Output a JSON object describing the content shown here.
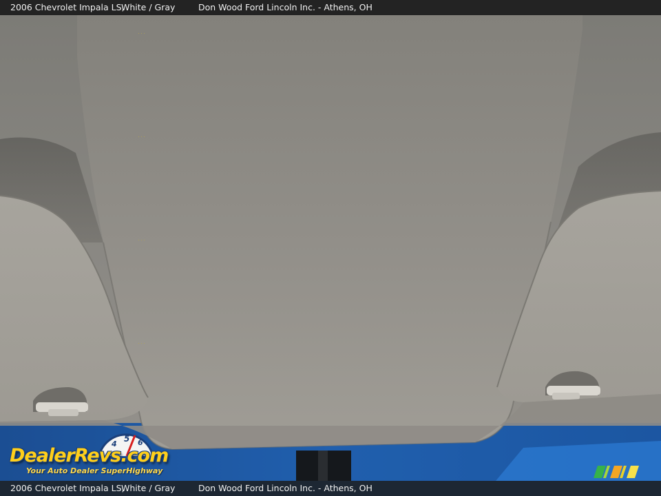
{
  "caption": {
    "vehicle": "2006 Chevrolet Impala LS,",
    "colors": "White / Gray",
    "dealer": "Don Wood Ford Lincoln Inc. - Athens, OH"
  },
  "watermark": {
    "brand": "DealerRevs.com",
    "tagline": "Your Auto Dealer SuperHighway",
    "gauge_digits": [
      "4",
      "5",
      "6"
    ]
  },
  "photo": {
    "subject": "headliner-and-sun-visors"
  },
  "colors": {
    "headliner": "#8a8882",
    "visor": "#a6a39c",
    "windshield": "#1d5fb0",
    "watermark_yellow": "#ffcf1a",
    "watermark_blue": "#1b3f7a"
  },
  "icons": [
    "speedometer-gauge-icon",
    "brand-stripes-icon"
  ]
}
